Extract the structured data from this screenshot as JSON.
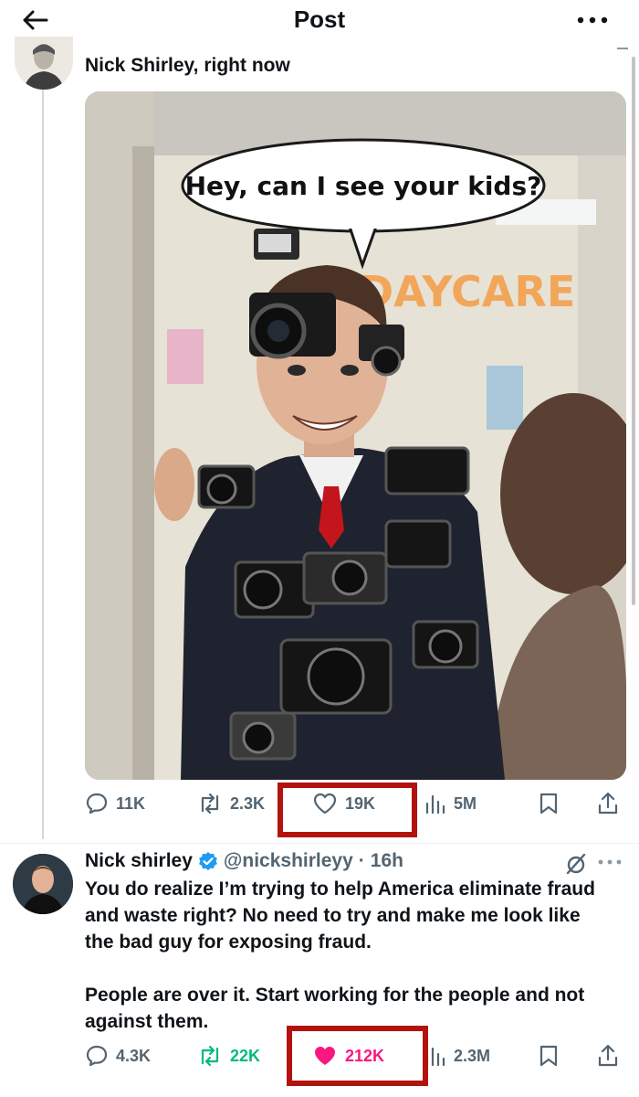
{
  "header": {
    "title": "Post",
    "icons": [
      "back-arrow-icon",
      "more-horizontal-icon"
    ]
  },
  "post1": {
    "author": "Nick Shirley, right now",
    "image": {
      "speech_bubble": "Hey, can I see your kids?",
      "sign_text": "DAYCARE"
    },
    "stats": {
      "replies": "11K",
      "reposts": "2.3K",
      "likes": "19K",
      "views": "5M"
    }
  },
  "post2": {
    "name": "Nick shirley",
    "verified": true,
    "handle": "@nickshirleyy",
    "separator": "·",
    "time": "16h",
    "text": "You do realize I’m trying to help America eliminate fraud and waste right? No need to try and make me look like the bad guy for exposing fraud.\n\nPeople are over it. Start working for the people and not against them.",
    "stats": {
      "replies": "4.3K",
      "reposts": "22K",
      "likes": "212K",
      "views": "2.3M"
    },
    "reposted_by_viewer": true,
    "liked_by_viewer": true
  },
  "colors": {
    "accent_like": "#f91880",
    "accent_repost": "#00ba7c",
    "verified": "#1d9bf0",
    "annotation_box": "#b3130e",
    "muted": "#536471"
  }
}
